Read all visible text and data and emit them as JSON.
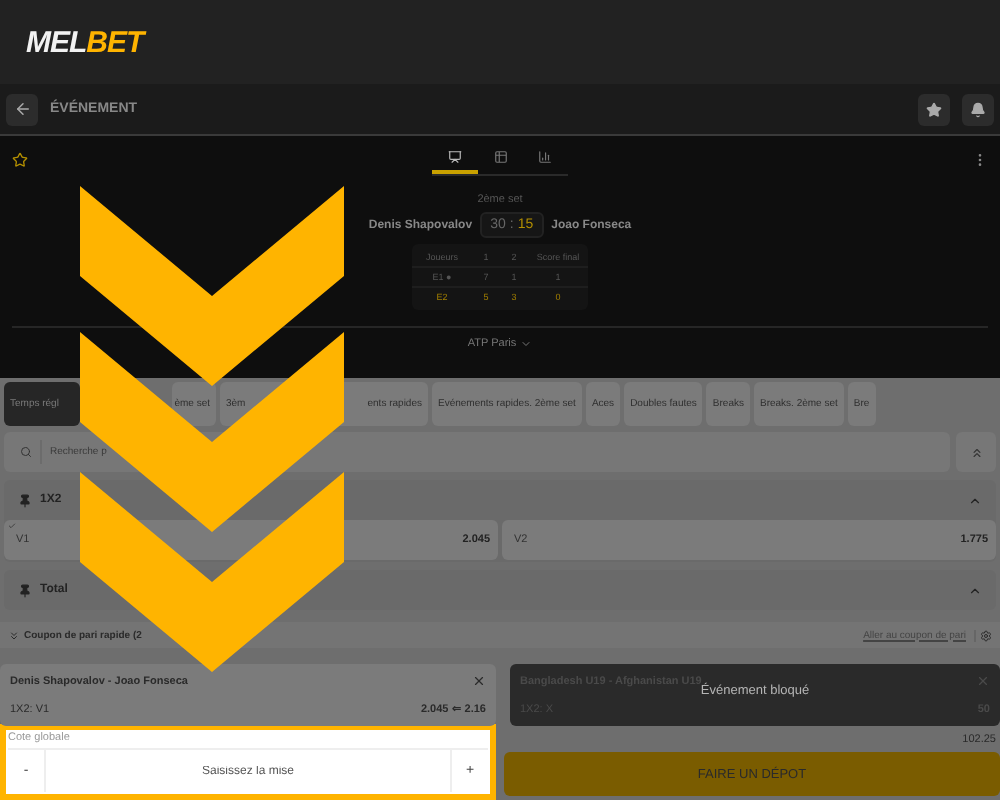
{
  "logo": {
    "part_1": "MEL",
    "part_2": "BET"
  },
  "nav": {
    "title": "ÉVÉNEMENT"
  },
  "match": {
    "view_tabs": [
      {
        "selected": true
      },
      {
        "selected": false
      },
      {
        "selected": false
      }
    ],
    "period": "2ème set",
    "home": "Denis Shapovalov",
    "away": "Joao Fonseca",
    "score_home": "30",
    "score_sep": ":",
    "score_away": "15",
    "score_table": {
      "columns": [
        "Joueurs",
        "1",
        "2",
        "Score final"
      ],
      "rows": [
        {
          "cells": [
            "E1",
            "7",
            "1",
            "1"
          ],
          "serving": true,
          "serve_mark": "●",
          "highlighted": false
        },
        {
          "cells": [
            "E2",
            "5",
            "3",
            "0"
          ],
          "serving": false,
          "highlighted": true
        }
      ]
    },
    "tournament": "ATP Paris"
  },
  "market_tabs": [
    {
      "parts": [
        "Temps régl"
      ],
      "selected": true
    },
    {
      "parts": [
        "ème set"
      ],
      "selected": false
    },
    {
      "parts": [
        "3èm",
        "ents rapides"
      ],
      "selected": false
    },
    {
      "parts": [
        "Evénements rapides. 2ème set"
      ],
      "selected": false
    },
    {
      "parts": [
        "Aces"
      ],
      "selected": false
    },
    {
      "parts": [
        "Doubles fautes"
      ],
      "selected": false
    },
    {
      "parts": [
        "Breaks"
      ],
      "selected": false
    },
    {
      "parts": [
        "Breaks. 2ème set"
      ],
      "selected": false
    },
    {
      "parts": [
        "Bre"
      ],
      "selected": false
    }
  ],
  "search": {
    "placeholder": "Recherche p"
  },
  "markets": [
    {
      "title": "1X2",
      "expanded": true,
      "outcomes": [
        {
          "label": "V1",
          "odds": "2.045",
          "selected": true
        },
        {
          "label": "V2",
          "odds": "1.775",
          "selected": false
        }
      ]
    },
    {
      "title": "Total",
      "expanded": true
    }
  ],
  "coupon": {
    "title": "Coupon de pari rapide (2",
    "link": "Aller au coupon de pari",
    "bets": [
      {
        "event": "Denis Shapovalov - Joao Fonseca",
        "market": "1X2: V1",
        "odds": "2.045 ⇐ 2.16",
        "blocked": false
      },
      {
        "event": "Bangladesh U19 - Afghanistan U19",
        "market": "1X2: X",
        "odds": "50",
        "blocked": true,
        "blocked_label": "Événement bloqué"
      }
    ],
    "total_label": "Cote globale",
    "total_value": "102.25",
    "minus": "-",
    "stake_placeholder": "Saisissez la mise",
    "plus": "+",
    "deposit": "FAIRE UN DÉPOT"
  }
}
